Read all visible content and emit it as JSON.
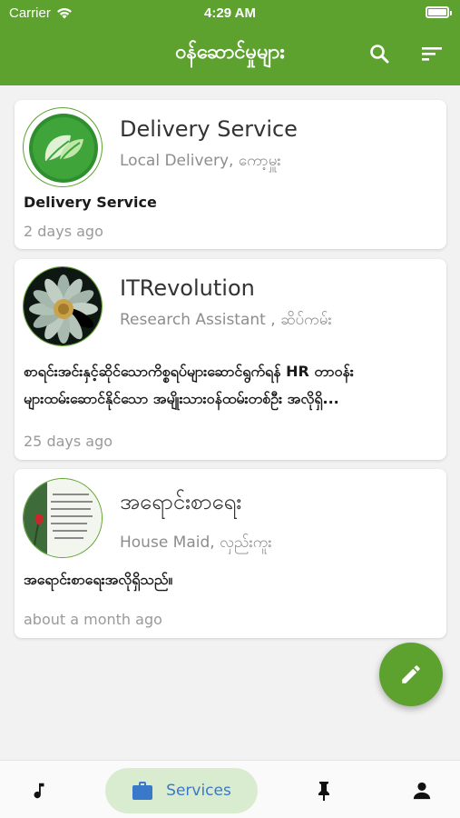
{
  "status_bar": {
    "carrier": "Carrier",
    "time": "4:29 AM"
  },
  "app_bar": {
    "title": "ဝန်ဆောင်မှုများ"
  },
  "jobs": [
    {
      "title": "Delivery Service",
      "subtitle": "Local Delivery, ကော့မှူး",
      "description": "Delivery Service",
      "time": "2 days ago"
    },
    {
      "title": "ITRevolution",
      "subtitle": "Research Assistant , ဆိပ်ကမ်း",
      "description": "စာရင်းအင်းနှင့်ဆိုင်သောကိစ္စရပ်များဆောင်ရွက်ရန် HR တာဝန်း\nများထမ်းဆောင်နိုင်သော အမျိုးသားဝန်ထမ်းတစ်ဦး အလိုရှိ...",
      "time": "25 days ago"
    },
    {
      "title": "အရောင်းစာရေး",
      "subtitle": "House Maid, လှည်းကူး",
      "description": "အရောင်းစာရေးအလိုရှိသည်။",
      "time": "about a month ago"
    }
  ],
  "bottom_nav": {
    "services_label": "Services"
  },
  "colors": {
    "primary": "#5da22e",
    "nav_active_bg": "#d9ecd0",
    "nav_active_text": "#3a78c9"
  }
}
